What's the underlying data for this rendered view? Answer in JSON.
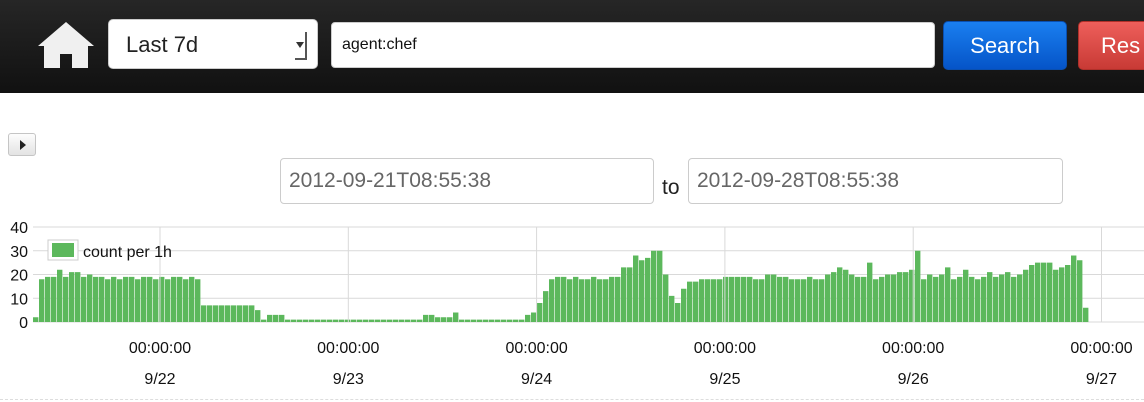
{
  "header": {
    "time_range": "Last 7d",
    "query": "agent:chef",
    "search_label": "Search",
    "reset_label": "Res"
  },
  "icons": {
    "home": "home-icon",
    "toggle": "play-triangle-icon"
  },
  "range": {
    "from": "2012-09-21T08:55:38",
    "to_label": "to",
    "to": "2012-09-28T08:55:38"
  },
  "colors": {
    "bar": "#5cb85c",
    "search": "#0d6ce6",
    "reset": "#da4f49"
  },
  "chart_data": {
    "type": "bar",
    "legend": "count per 1h",
    "legend_position": "top-left",
    "ylim": [
      0,
      40
    ],
    "yticks": [
      0,
      10,
      20,
      30,
      40
    ],
    "grid": true,
    "x_ticks": [
      {
        "time": "00:00:00",
        "date": "9/22"
      },
      {
        "time": "00:00:00",
        "date": "9/23"
      },
      {
        "time": "00:00:00",
        "date": "9/24"
      },
      {
        "time": "00:00:00",
        "date": "9/25"
      },
      {
        "time": "00:00:00",
        "date": "9/26"
      },
      {
        "time": "00:00:00",
        "date": "9/27"
      }
    ],
    "values": [
      2,
      18,
      19,
      19,
      22,
      19,
      21,
      21,
      19,
      20,
      19,
      19,
      18,
      19,
      18,
      19,
      19,
      18,
      19,
      19,
      18,
      19,
      18,
      19,
      19,
      18,
      19,
      18,
      7,
      7,
      7,
      7,
      7,
      7,
      7,
      7,
      7,
      5,
      1,
      3,
      3,
      3,
      1,
      1,
      1,
      1,
      1,
      1,
      1,
      1,
      1,
      1,
      1,
      1,
      1,
      1,
      1,
      1,
      1,
      1,
      1,
      1,
      1,
      1,
      1,
      3,
      3,
      2,
      2,
      2,
      4,
      1,
      1,
      1,
      1,
      1,
      1,
      1,
      1,
      1,
      1,
      1,
      3,
      4,
      8,
      13,
      18,
      19,
      19,
      18,
      19,
      18,
      18,
      19,
      18,
      18,
      19,
      19,
      23,
      23,
      28,
      26,
      27,
      30,
      30,
      20,
      11,
      8,
      14,
      17,
      17,
      18,
      18,
      18,
      18,
      19,
      19,
      19,
      19,
      19,
      18,
      18,
      20,
      20,
      19,
      19,
      18,
      18,
      18,
      19,
      18,
      18,
      20,
      21,
      23,
      22,
      20,
      19,
      19,
      25,
      18,
      19,
      20,
      20,
      21,
      21,
      22,
      30,
      18,
      20,
      19,
      20,
      23,
      18,
      19,
      22,
      19,
      18,
      19,
      21,
      19,
      20,
      21,
      19,
      20,
      22,
      24,
      25,
      25,
      25,
      22,
      23,
      24,
      28,
      26,
      6
    ]
  }
}
